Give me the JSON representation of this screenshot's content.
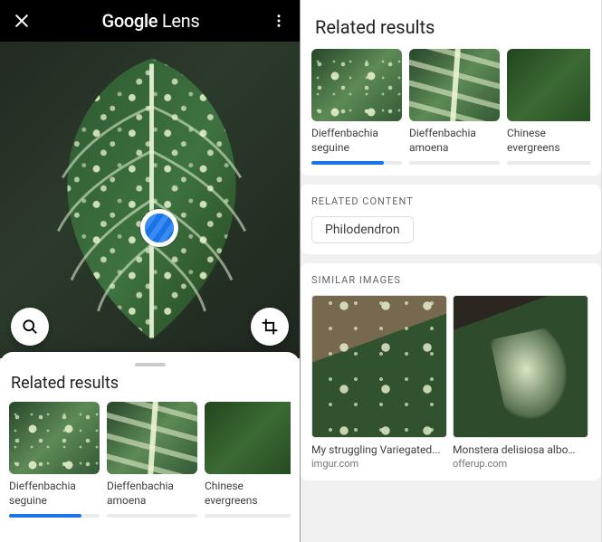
{
  "left": {
    "app_title_html": "Google Lens",
    "sheet_title": "Related results",
    "cards": [
      {
        "label": "Dieffenbachia seguine",
        "progress": 80
      },
      {
        "label": "Dieffenbachia amoena",
        "progress": 0
      },
      {
        "label": "Chinese evergreens",
        "progress": 0
      }
    ]
  },
  "right": {
    "title": "Related results",
    "cards": [
      {
        "label": "Dieffenbachia seguine",
        "progress": 80
      },
      {
        "label": "Dieffenbachia amoena",
        "progress": 0
      },
      {
        "label": "Chinese evergreens",
        "progress": 0
      }
    ],
    "related_content": {
      "label": "RELATED CONTENT",
      "chips": [
        "Philodendron"
      ]
    },
    "similar": {
      "label": "SIMILAR IMAGES",
      "items": [
        {
          "caption": "My struggling Variegated...",
          "source": "imgur.com"
        },
        {
          "caption": "Monstera delisiosa albo…",
          "source": "offerup.com"
        }
      ]
    }
  },
  "icons": {
    "close": "close-icon",
    "more": "more-vert-icon",
    "search": "search-icon",
    "crop": "crop-icon"
  }
}
